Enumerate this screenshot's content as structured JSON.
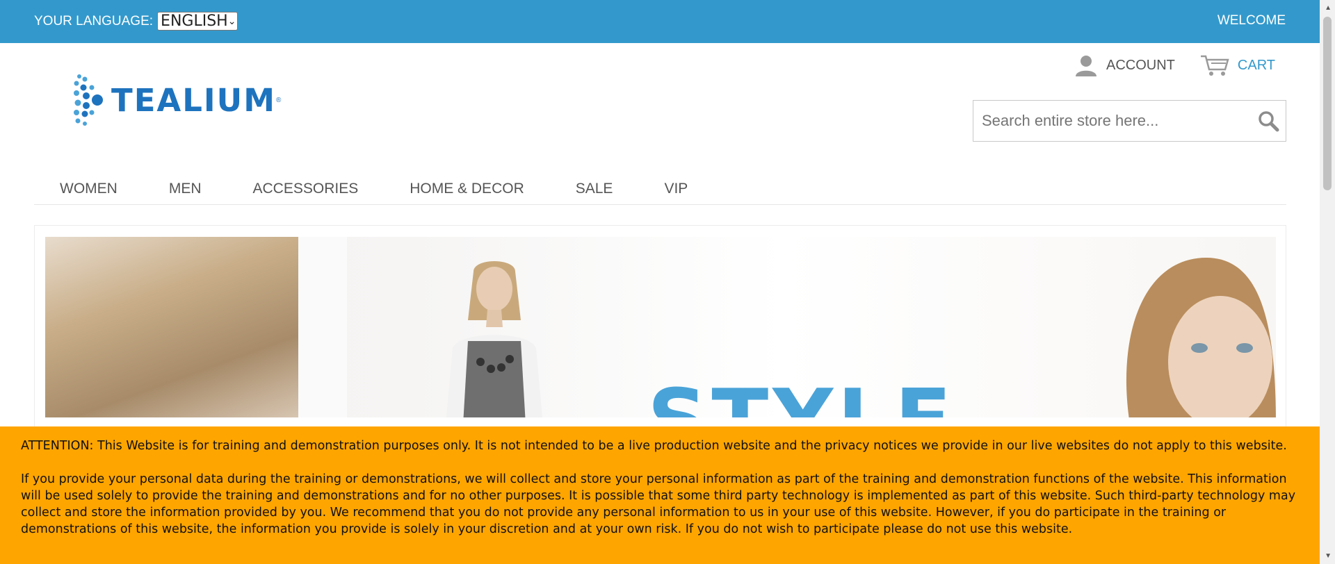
{
  "topbar": {
    "language_label": "YOUR LANGUAGE:",
    "language_value": "English",
    "welcome": "WELCOME"
  },
  "header": {
    "account_label": "ACCOUNT",
    "cart_label": "CART",
    "logo_text": "TEALIUM",
    "search_placeholder": "Search entire store here..."
  },
  "nav": {
    "items": [
      "WOMEN",
      "MEN",
      "ACCESSORIES",
      "HOME & DECOR",
      "SALE",
      "VIP"
    ]
  },
  "hero": {
    "headline": "STYLE"
  },
  "notice": {
    "paragraph1": "ATTENTION: This Website is for training and demonstration purposes only. It is not intended to be a live production website and the privacy notices we provide in our live websites do not apply to this website.",
    "paragraph2": "If you provide your personal data during the training or demonstrations, we will collect and store your personal information as part of the training and demonstration functions of the website. This information will be used solely to provide the training and demonstrations and for no other purposes. It is possible that some third party technology is implemented as part of this website. Such third-party technology may collect and store the information provided by you. We recommend that you do not provide any personal information to us in your use of this website. However, if you do participate in the training or demonstrations of this website, the information you provide is solely in your discretion and at your own risk. If you do not wish to participate please do not use this website."
  },
  "colors": {
    "brand_blue": "#3399cc",
    "notice_orange": "#ffa500"
  }
}
